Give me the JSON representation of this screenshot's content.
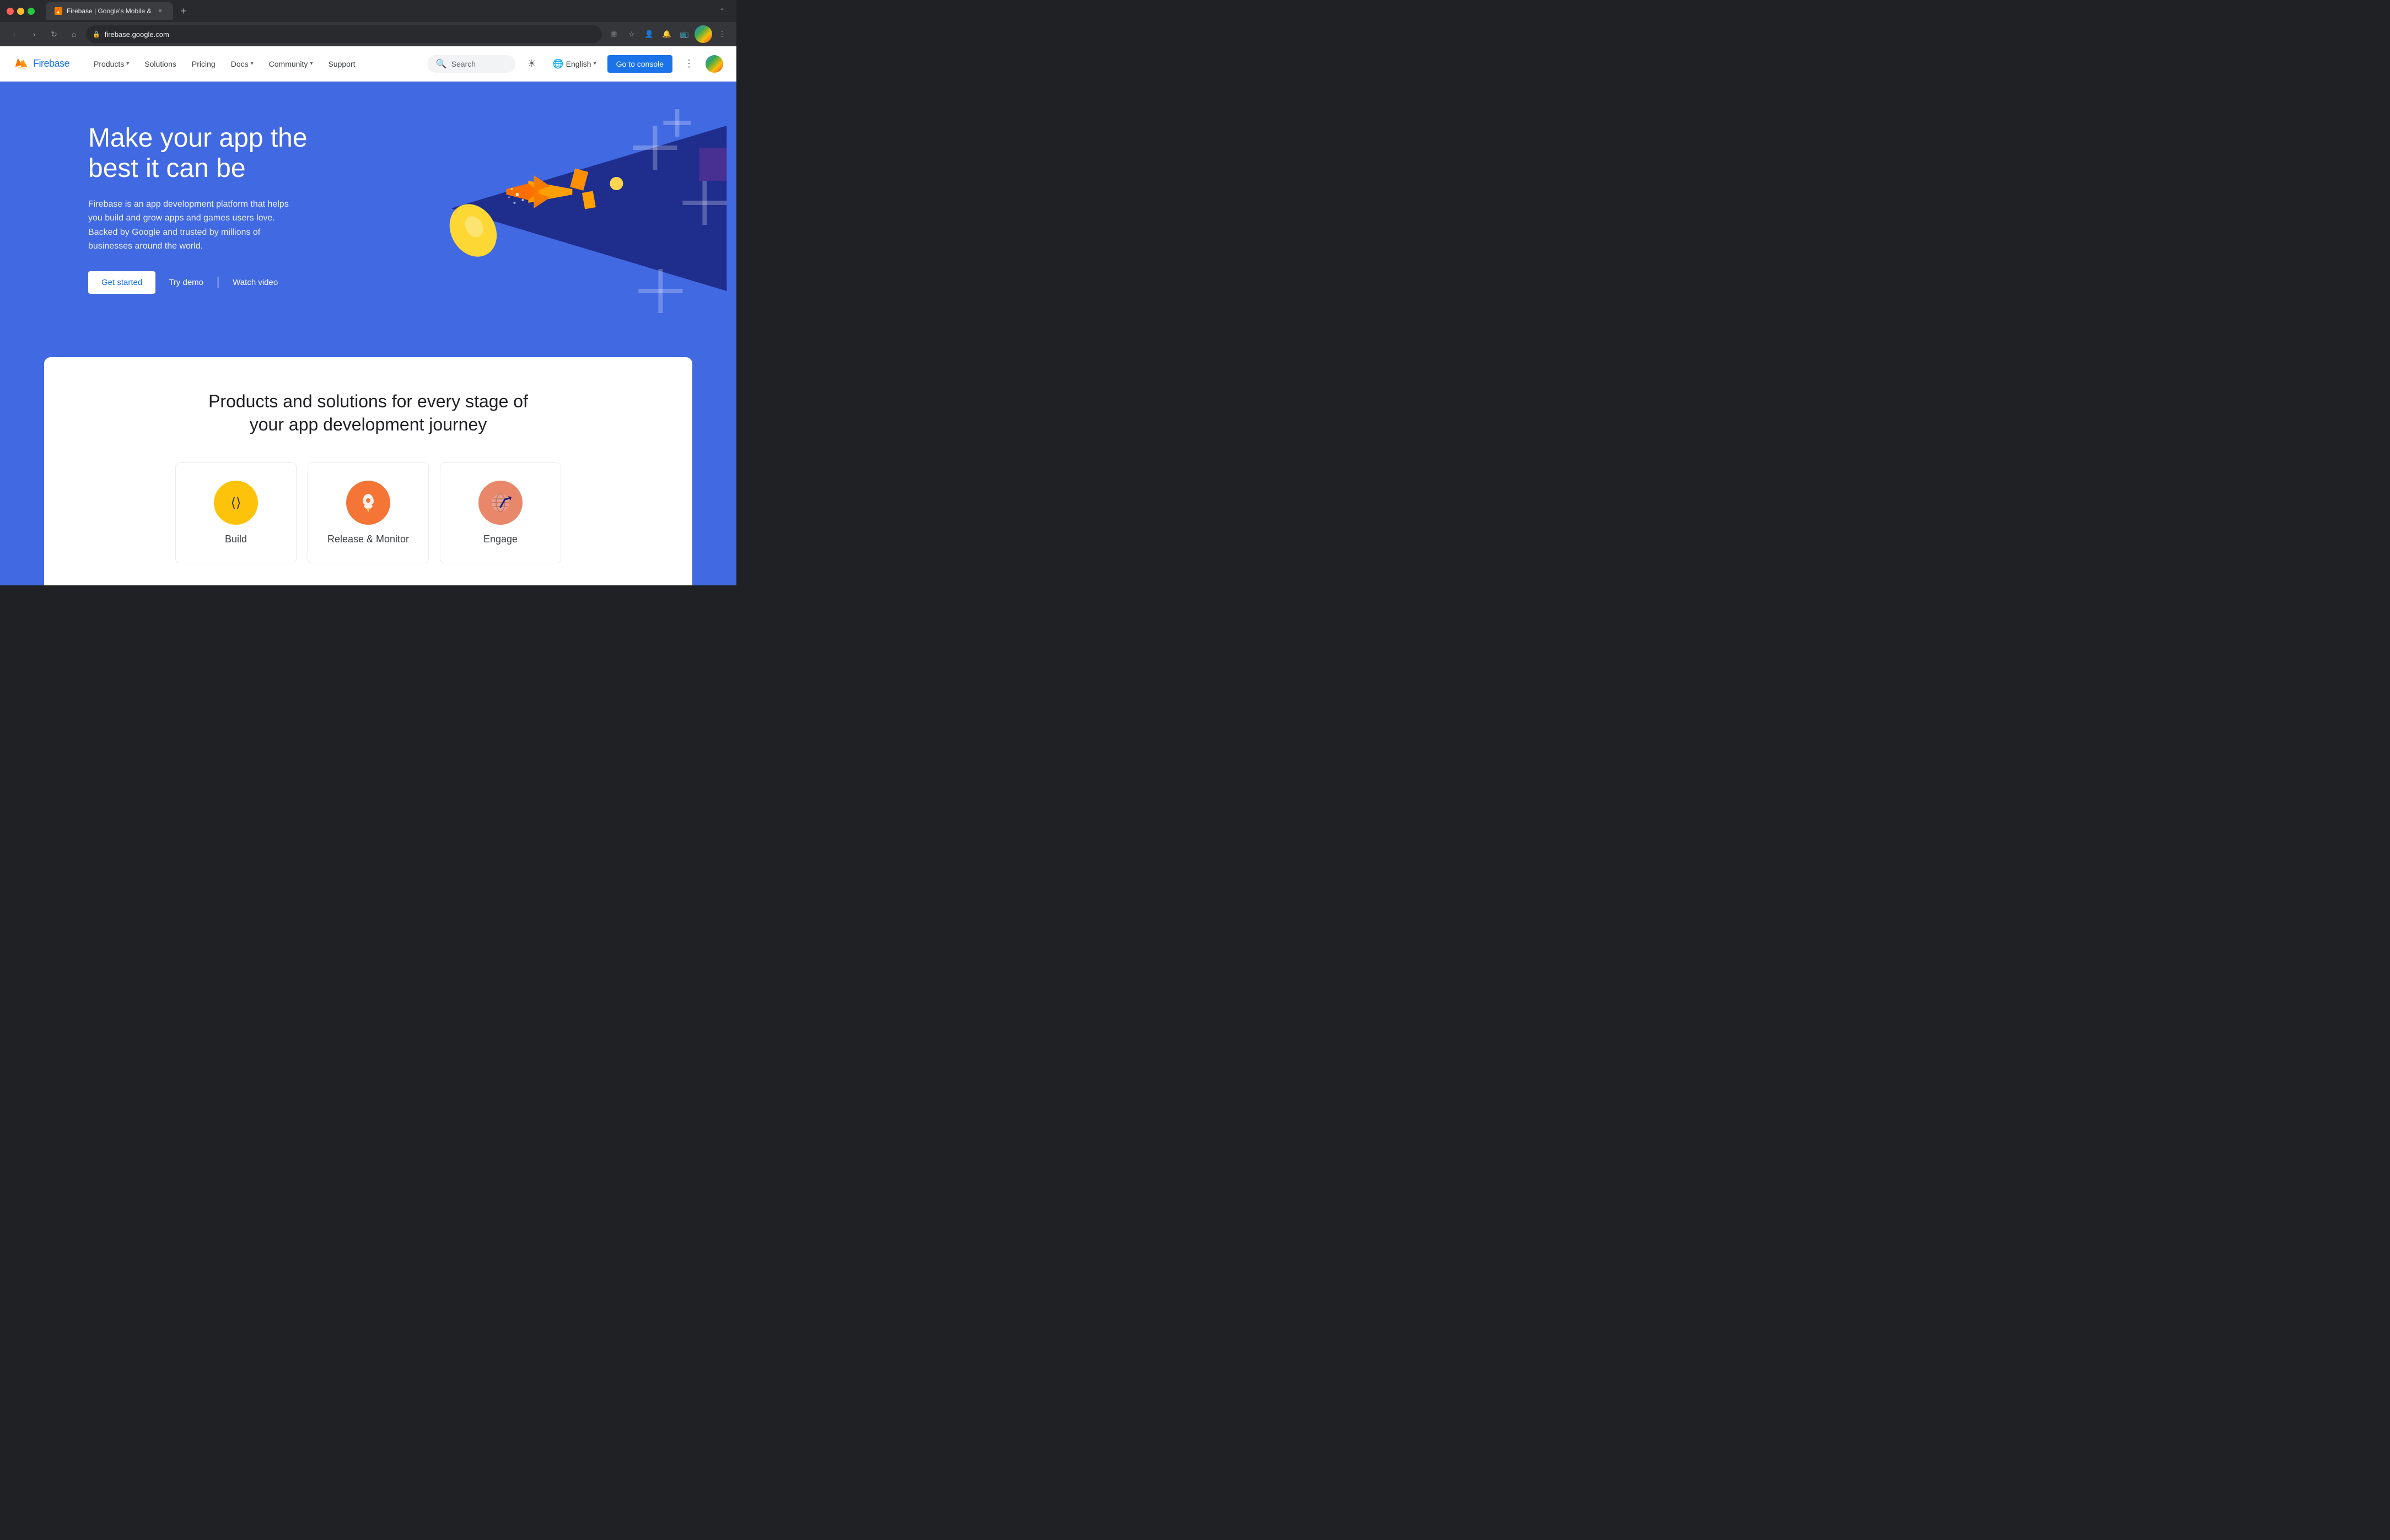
{
  "browser": {
    "tab_title": "Firebase | Google's Mobile &",
    "url": "firebase.google.com",
    "nav_back": "‹",
    "nav_forward": "›",
    "nav_reload": "↻",
    "nav_home": "⌂"
  },
  "navbar": {
    "brand": "Firebase",
    "links": [
      {
        "label": "Products",
        "has_dropdown": true
      },
      {
        "label": "Solutions",
        "has_dropdown": false
      },
      {
        "label": "Pricing",
        "has_dropdown": false
      },
      {
        "label": "Docs",
        "has_dropdown": true
      },
      {
        "label": "Community",
        "has_dropdown": true
      },
      {
        "label": "Support",
        "has_dropdown": false
      }
    ],
    "search_placeholder": "Search",
    "language": "English",
    "console_label": "Go to console"
  },
  "hero": {
    "title": "Make your app the best it can be",
    "description": "Firebase is an app development platform that helps you build and grow apps and games users love. Backed by Google and trusted by millions of businesses around the world.",
    "btn_get_started": "Get started",
    "btn_try_demo": "Try demo",
    "btn_divider": "|",
    "btn_watch_video": "Watch video"
  },
  "products": {
    "title": "Products and solutions for every stage of your app development journey",
    "items": [
      {
        "name": "Build",
        "icon": "◇",
        "color": "build"
      },
      {
        "name": "Release & Monitor",
        "icon": "🚀",
        "color": "release"
      },
      {
        "name": "Engage",
        "icon": "📈",
        "color": "engage"
      }
    ]
  }
}
